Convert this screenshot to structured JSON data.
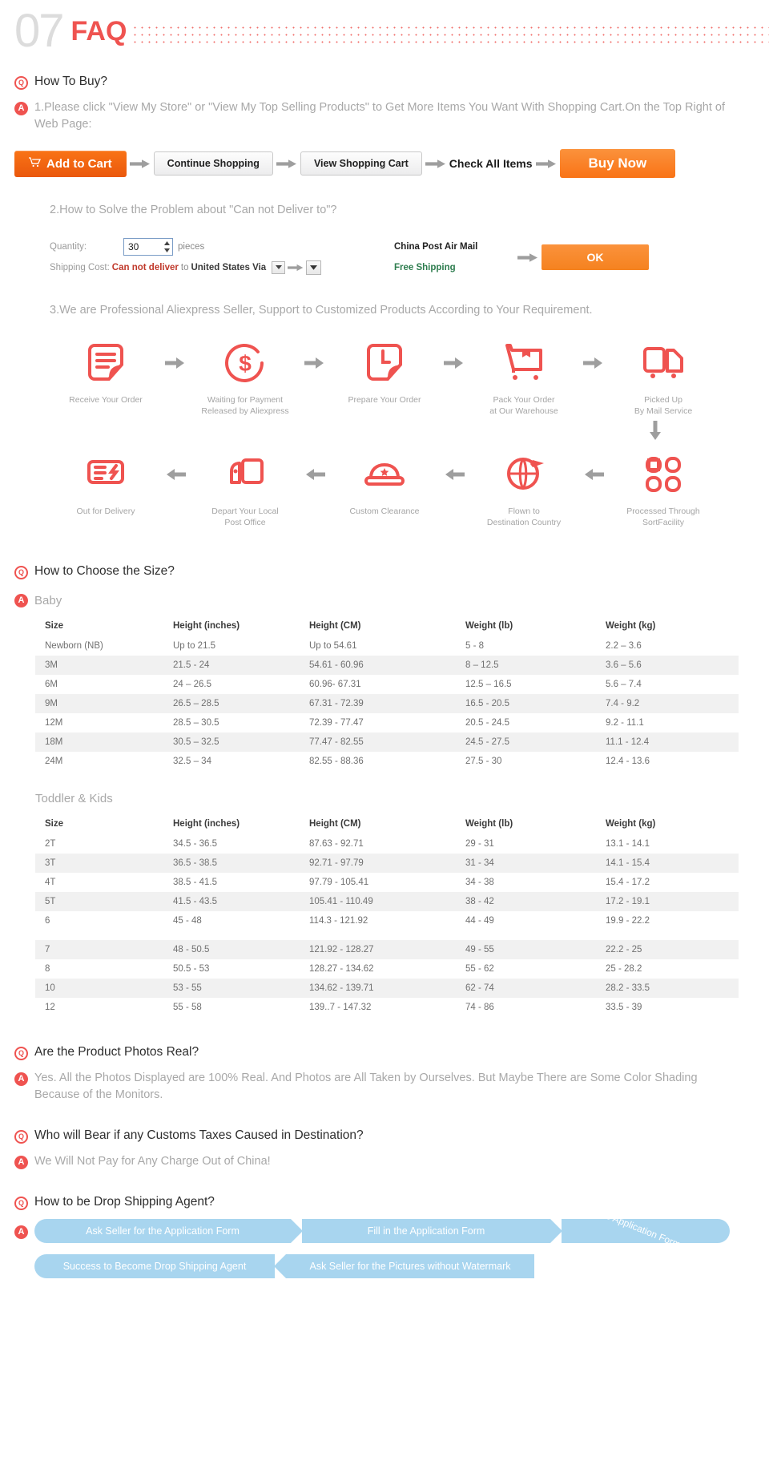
{
  "header": {
    "number": "07",
    "title": "FAQ"
  },
  "q1": {
    "question": "How To Buy?",
    "answer1": "1.Please click \"View My Store\" or \"View My Top Selling Products\" to Get More Items You Want With Shopping Cart.On the Top Right of Web Page:",
    "buttons": {
      "add_to_cart": "Add to Cart",
      "continue_shopping": "Continue Shopping",
      "view_cart": "View Shopping Cart",
      "check_all": "Check All Items",
      "buy_now": "Buy Now"
    },
    "answer2": "2.How to Solve the Problem about \"Can not Deliver to\"?",
    "form": {
      "quantity_label": "Quantity:",
      "quantity_value": "30",
      "pieces": "pieces",
      "shipping_label": "Shipping Cost:",
      "shipping_error": "Can not deliver",
      "shipping_to": "to",
      "shipping_country": "United States Via",
      "carrier": "China Post Air Mail",
      "free_shipping": "Free Shipping",
      "ok_button": "OK",
      "select_caret": "▼"
    },
    "answer3": "3.We are Professional Aliexpress Seller, Support to Customized Products According to Your Requirement.",
    "process_row1": [
      {
        "icon": "document-icon",
        "label": "Receive Your Order"
      },
      {
        "icon": "dollar-circle-icon",
        "label": "Waiting for Payment\nReleased by Aliexpress"
      },
      {
        "icon": "clock-document-icon",
        "label": "Prepare Your Order"
      },
      {
        "icon": "shopping-cart-box-icon",
        "label": "Pack Your Order\nat Our Warehouse"
      },
      {
        "icon": "truck-icon",
        "label": "Picked Up\nBy Mail Service"
      }
    ],
    "process_row2": [
      {
        "icon": "delivery-van-icon",
        "label": "Out for Delivery"
      },
      {
        "icon": "post-office-icon",
        "label": "Depart Your Local\nPost Office"
      },
      {
        "icon": "customs-hat-icon",
        "label": "Custom Clearance"
      },
      {
        "icon": "globe-plane-icon",
        "label": "Flown to\nDestination Country"
      },
      {
        "icon": "sort-facility-icon",
        "label": "Processed Through\nSortFacility"
      }
    ]
  },
  "q2": {
    "question": "How to Choose the Size?",
    "baby_label": "Baby",
    "toddler_label": "Toddler & Kids",
    "columns": [
      "Size",
      "Height (inches)",
      "Height (CM)",
      "Weight (lb)",
      "Weight (kg)"
    ],
    "baby_rows": [
      [
        "Newborn (NB)",
        "Up to 21.5",
        "Up to 54.61",
        "5 - 8",
        "2.2 – 3.6"
      ],
      [
        "3M",
        "21.5 - 24",
        "54.61 - 60.96",
        "8 – 12.5",
        "3.6 – 5.6"
      ],
      [
        "6M",
        "24 – 26.5",
        "60.96- 67.31",
        "12.5 – 16.5",
        "5.6 – 7.4"
      ],
      [
        "9M",
        "26.5 – 28.5",
        "67.31 - 72.39",
        "16.5 - 20.5",
        "7.4 - 9.2"
      ],
      [
        "12M",
        "28.5 – 30.5",
        "72.39 - 77.47",
        "20.5 - 24.5",
        "9.2 - 11.1"
      ],
      [
        "18M",
        "30.5 – 32.5",
        "77.47 - 82.55",
        "24.5 - 27.5",
        "11.1 - 12.4"
      ],
      [
        "24M",
        "32.5 – 34",
        "82.55 - 88.36",
        "27.5 - 30",
        "12.4 - 13.6"
      ]
    ],
    "kids_rows": [
      [
        "2T",
        "34.5 - 36.5",
        "87.63 - 92.71",
        "29 - 31",
        "13.1 - 14.1"
      ],
      [
        "3T",
        "36.5 - 38.5",
        "92.71 - 97.79",
        "31 - 34",
        "14.1 - 15.4"
      ],
      [
        "4T",
        "38.5 - 41.5",
        "97.79 - 105.41",
        "34 - 38",
        "15.4 - 17.2"
      ],
      [
        "5T",
        "41.5 - 43.5",
        "105.41 - 110.49",
        "38 - 42",
        "17.2 - 19.1"
      ],
      [
        "6",
        "45 - 48",
        "114.3 - 121.92",
        "44 - 49",
        "19.9 - 22.2"
      ],
      [
        "7",
        "48 - 50.5",
        "121.92 - 128.27",
        "49 - 55",
        "22.2 - 25"
      ],
      [
        "8",
        "50.5 - 53",
        "128.27 - 134.62",
        "55 - 62",
        "25 - 28.2"
      ],
      [
        "10",
        "53 - 55",
        "134.62 - 139.71",
        "62 - 74",
        "28.2 - 33.5"
      ],
      [
        "12",
        "55 - 58",
        "139..7 - 147.32",
        "74 - 86",
        "33.5 - 39"
      ]
    ]
  },
  "q3": {
    "question": "Are the Product Photos Real?",
    "answer": "Yes. All the Photos Displayed are 100% Real. And Photos are All Taken by Ourselves. But Maybe There are Some Color Shading Because of the Monitors."
  },
  "q4": {
    "question": "Who will Bear if any Customs Taxes Caused in Destination?",
    "answer": "We Will Not Pay for Any Charge Out of China!"
  },
  "q5": {
    "question": "How to be Drop Shipping Agent?",
    "steps": [
      "Ask Seller for the Application Form",
      "Fill in the Application Form",
      "Give the Application Form to Seler",
      "Ask Seller for the Pictures without Watermark",
      "Success to Become Drop Shipping Agent"
    ]
  },
  "colors": {
    "accent": "#ef5350",
    "orange": "#f5821f",
    "cart_orange": "#ea580c",
    "ribbon_blue": "#a8d5ef",
    "green": "#2e7d4f",
    "red_error": "#c0392b"
  }
}
